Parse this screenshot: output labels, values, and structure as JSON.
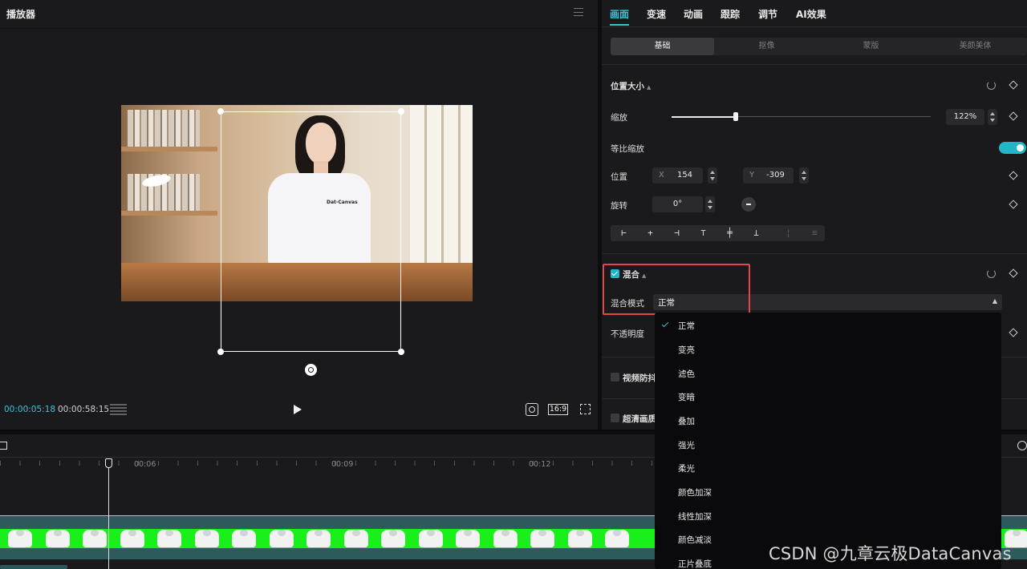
{
  "player": {
    "title": "播放器",
    "timecode_current": "00:00:05:18",
    "timecode_total": "00:00:58:15",
    "aspect_ratio": "16:9",
    "shirt_text": "Dat-Canvas"
  },
  "panel": {
    "tabs": [
      "画面",
      "变速",
      "动画",
      "跟踪",
      "调节",
      "AI效果"
    ],
    "active_tab": "画面",
    "subtabs": [
      "基础",
      "抠像",
      "蒙版",
      "美颜美体"
    ],
    "active_subtab": "基础",
    "position_size": {
      "header": "位置大小",
      "scale_label": "缩放",
      "scale_value": "122%",
      "uniform_scale_label": "等比缩放",
      "uniform_scale_on": true,
      "position_label": "位置",
      "x_axis": "X",
      "x_value": "154",
      "y_axis": "Y",
      "y_value": "-309",
      "rotation_label": "旋转",
      "rotation_value": "0°"
    },
    "blend": {
      "header": "混合",
      "enabled": true,
      "mode_label": "混合模式",
      "mode_value": "正常",
      "opacity_label": "不透明度"
    },
    "stabilize_label": "视频防抖",
    "enhance_label": "超清画质"
  },
  "dropdown": {
    "options": [
      "正常",
      "变亮",
      "滤色",
      "变暗",
      "叠加",
      "强光",
      "柔光",
      "颜色加深",
      "线性加深",
      "颜色减淡",
      "正片叠底"
    ],
    "selected": "正常"
  },
  "timeline": {
    "ruler_labels": [
      "00:06",
      "00:09",
      "00:12"
    ]
  },
  "watermark": "CSDN @九章云极DataCanvas",
  "colors": {
    "accent": "#35c6d6",
    "highlight_box": "#e2474a",
    "green_screen": "#19f019"
  }
}
